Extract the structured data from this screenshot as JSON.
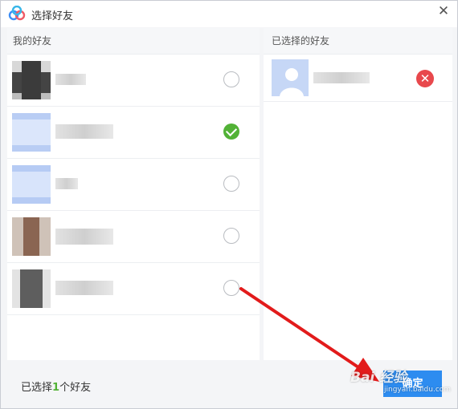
{
  "window": {
    "title": "选择好友",
    "close_glyph": "✕",
    "logo_icon": "app-logo-icon"
  },
  "left_panel": {
    "header": "我的好友",
    "friends": [
      {
        "avatar_colors": [
          "#3a3a3a",
          "#d9d9d9"
        ],
        "checked": false
      },
      {
        "avatar_colors": [
          "#b9cdf4",
          "#dbe6fb"
        ],
        "checked": true
      },
      {
        "avatar_colors": [
          "#b6cbf4",
          "#d8e4fb"
        ],
        "checked": false
      },
      {
        "avatar_colors": [
          "#8a6552",
          "#e3d7d0"
        ],
        "checked": false
      },
      {
        "avatar_colors": [
          "#5e5e5e",
          "#d2c8bf"
        ],
        "checked": false
      }
    ]
  },
  "right_panel": {
    "header": "已选择的好友",
    "remove_glyph": "✕"
  },
  "footer": {
    "count_prefix": "已选择",
    "count_value": "1",
    "count_suffix": "个好友",
    "confirm_label": "确定"
  },
  "watermark": {
    "main": "Bai 经验",
    "sub": "jingyan.baidu.com"
  },
  "colors": {
    "accent_blue": "#2d8cf0",
    "check_green": "#52b236",
    "remove_red": "#e8484c",
    "annotation_red": "#e21b1b"
  }
}
